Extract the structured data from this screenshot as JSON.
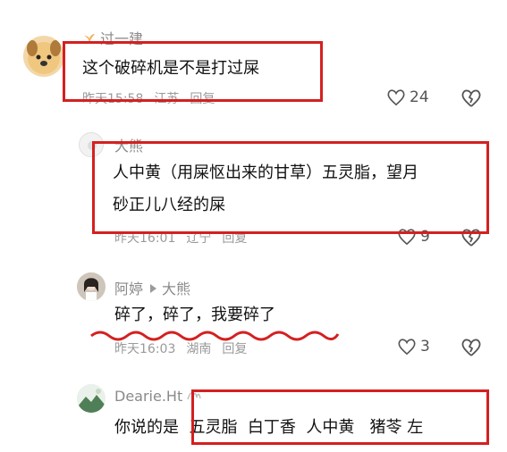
{
  "comments": [
    {
      "user": "过一建",
      "text": "这个破碎机是不是打过屎",
      "time": "昨天15:58",
      "location": "江苏",
      "reply_label": "回复",
      "likes": "24"
    },
    {
      "user": "大熊",
      "text_line1": "人中黄（用屎怄出来的甘草）五灵脂，望月",
      "text_line2": "砂正儿八经的屎",
      "time": "昨天16:01",
      "location": "辽宁",
      "reply_label": "回复",
      "likes": "9"
    },
    {
      "user": "阿婷",
      "reply_to": "大熊",
      "text": "碎了，碎了，我要碎了",
      "time": "昨天16:03",
      "location": "湖南",
      "reply_label": "回复",
      "likes": "3"
    },
    {
      "user": "Dearie.Ht",
      "text_prefix": "你说的是",
      "text_highlight": "五灵脂  白丁香  人中黄   猪苓 左"
    }
  ],
  "colors": {
    "highlight_box": "#d42020",
    "meta_text": "#9a9a9a"
  }
}
